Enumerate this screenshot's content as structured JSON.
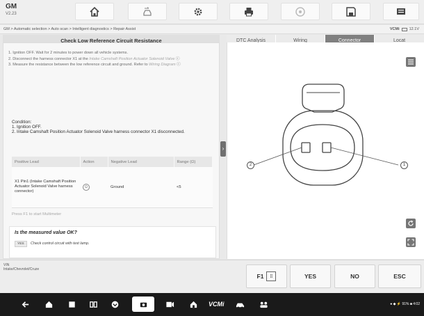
{
  "brand": {
    "name": "GM",
    "version": "V2.23"
  },
  "toolbar": {
    "icons": [
      "home-icon",
      "vehicle-swap-icon",
      "gear-icon",
      "printer-icon",
      "help-icon",
      "save-icon",
      "message-icon"
    ]
  },
  "breadcrumb": "GM > Automatic selection > Auto scan > Intelligent diagnostics > Repair Assist",
  "vcm_status": {
    "label": "VCMi",
    "voltage": "12.1V"
  },
  "left_panel": {
    "title": "Check Low Reference Circuit Resistance",
    "steps": [
      {
        "text": "1. Ignition OFF. Wait for 2 minutes to power down all vehicle systems.",
        "link": ""
      },
      {
        "text": "2. Disconnect the harness connector X1 at the ",
        "link": "Intake Camshaft Position Actuator Solenoid Valve"
      },
      {
        "text": "3. Measure the resistance between the low reference circuit and ground. Refer to ",
        "link": "Wiring Diagram"
      }
    ],
    "condition": {
      "label": "Condition:",
      "lines": [
        "1. Ignition OFF.",
        "2. Intake Camshaft Position Actuator Solenoid Valve harness connector X1 disconnected."
      ]
    },
    "table": {
      "headers": [
        "Positive Lead",
        "Action",
        "Negative Lead",
        "Range (Ω)"
      ],
      "rows": [
        {
          "positive": "X1 Pin1 (Intake Camshaft Position Actuator Solenoid Valve harness connector)",
          "action": "Ω",
          "negative": "Ground",
          "range": "<5"
        }
      ]
    },
    "press_hint": "Press F1 to start Multimeter",
    "question": {
      "title": "Is the measured value OK?",
      "yes_label": "YES",
      "yes_text": "Check control circuit with test lamp."
    }
  },
  "right_panel": {
    "tabs": [
      {
        "label": "DTC Analysis",
        "active": false
      },
      {
        "label": "Wiring",
        "active": false
      },
      {
        "label": "Connector",
        "active": true
      },
      {
        "label": "Locat",
        "active": false
      }
    ],
    "pins": {
      "left": "2",
      "right": "1"
    }
  },
  "vehicle_info": {
    "line1": "VIN",
    "line2": "Intake/Chevrolet/Cruze"
  },
  "actions": [
    {
      "label": "F1",
      "icon": "multimeter-icon"
    },
    {
      "label": "YES"
    },
    {
      "label": "NO"
    },
    {
      "label": "ESC"
    }
  ],
  "navbar": {
    "vcm_label": "VCMi",
    "status": "● ◆ ⚡ 91% ■ 4:02"
  },
  "colors": {
    "active_tab": "#808080",
    "nav_bg": "#1a1a1a",
    "panel_bg": "#f7f7f7"
  }
}
